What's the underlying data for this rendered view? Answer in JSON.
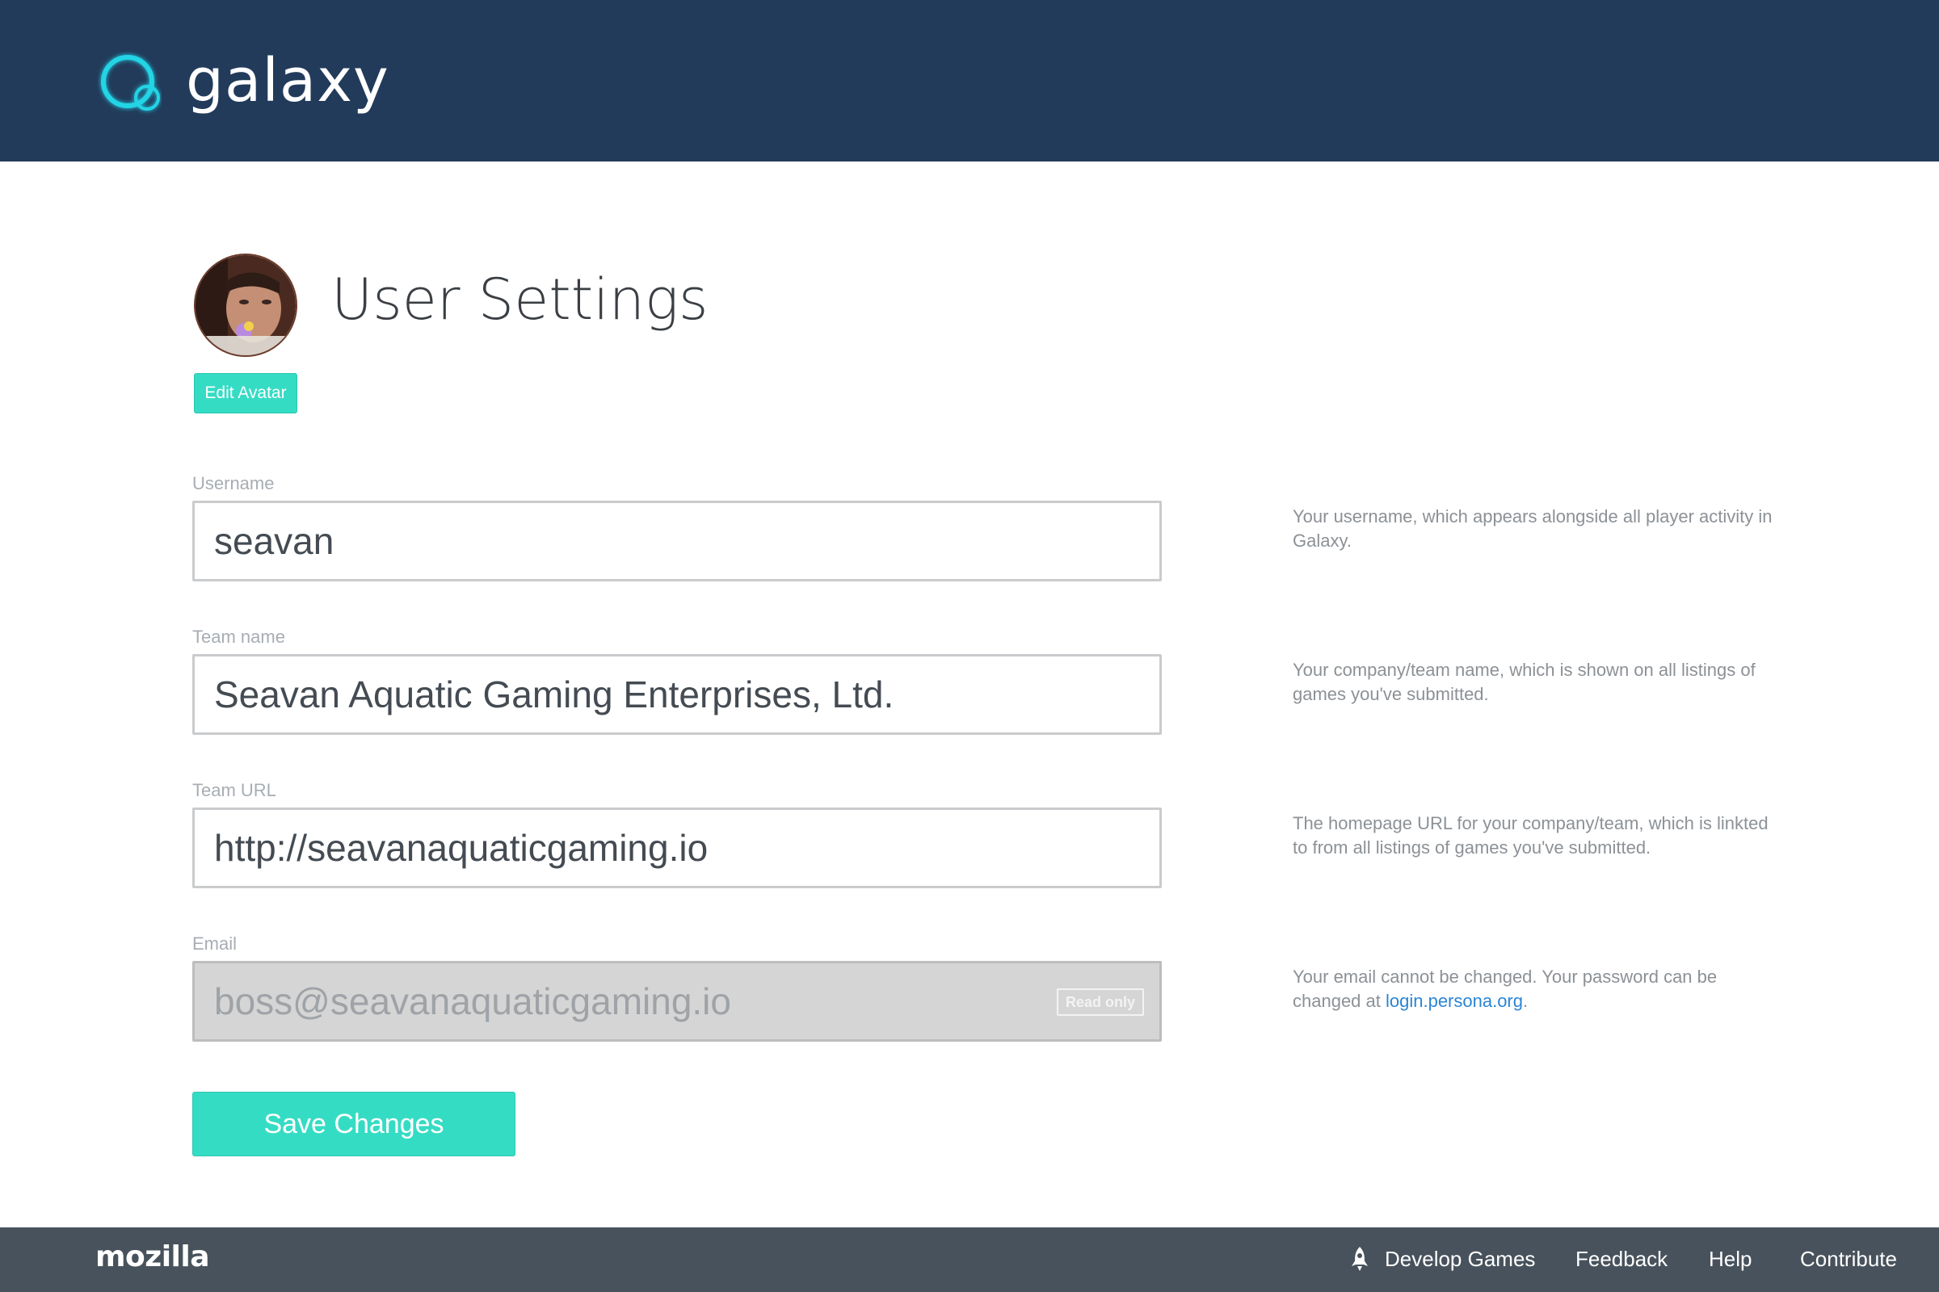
{
  "header": {
    "brand": "galaxy",
    "logo_icon": "galaxy-ring-logo",
    "background_color": "#223b5b",
    "logo_glow_color": "#21d4e6"
  },
  "profile": {
    "title": "User Settings",
    "edit_avatar_label": "Edit Avatar",
    "avatar_icon": "user-avatar-photo"
  },
  "form": {
    "username": {
      "label": "Username",
      "value": "seavan",
      "help": "Your username, which appears alongside all player activity in Galaxy."
    },
    "team_name": {
      "label": "Team name",
      "value": "Seavan Aquatic Gaming Enterprises, Ltd.",
      "help": "Your company/team name, which is shown on all listings of games you've submitted."
    },
    "team_url": {
      "label": "Team URL",
      "value": "http://seavanaquaticgaming.io",
      "help": "The homepage URL for your company/team, which is linkted to from all listings of games you've submitted."
    },
    "email": {
      "label": "Email",
      "value": "boss@seavanaquaticgaming.io",
      "readonly_badge": "Read only",
      "help_prefix": "Your email cannot be changed. Your password can be changed at ",
      "help_link": "login.persona.org",
      "help_suffix": "."
    },
    "save_label": "Save Changes",
    "accent_color": "#35dcc4"
  },
  "footer": {
    "brand": "mozilla",
    "links": {
      "develop_games": "Develop Games",
      "feedback": "Feedback",
      "help": "Help",
      "contribute": "Contribute"
    },
    "develop_icon": "rocket-icon"
  }
}
